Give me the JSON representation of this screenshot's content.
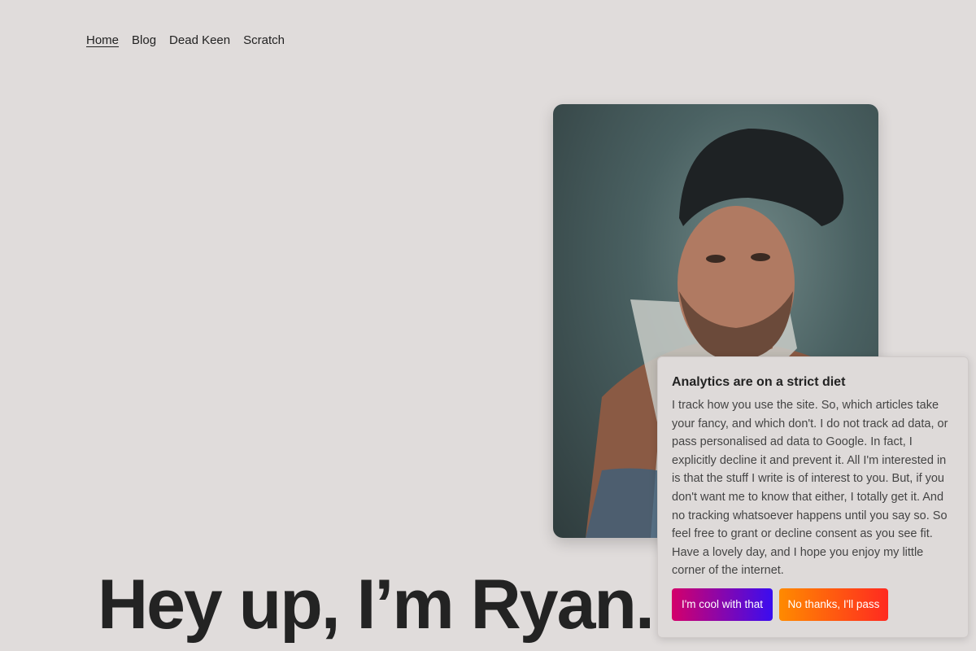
{
  "nav": {
    "items": [
      {
        "label": "Home",
        "active": true
      },
      {
        "label": "Blog",
        "active": false
      },
      {
        "label": "Dead Keen",
        "active": false
      },
      {
        "label": "Scratch",
        "active": false
      }
    ]
  },
  "hero": {
    "title": "Hey up, I’m Ryan."
  },
  "portrait": {
    "subject": "portrait-photo"
  },
  "consent": {
    "title": "Analytics are on a strict diet",
    "body": "I track how you use the site. So, which articles take your fancy, and which don't. I do not track ad data, or pass personalised ad data to Google. In fact, I explicitly decline it and prevent it. All I'm interested in is that the stuff I write is of interest to you. But, if you don't want me to know that either, I totally get it. And no tracking whatsoever happens until you say so. So feel free to grant or decline consent as you see fit. Have a lovely day, and I hope you enjoy my little corner of the internet.",
    "accept_label": "I'm cool with that",
    "decline_label": "No thanks, I'll pass"
  },
  "colors": {
    "background": "#e0dcdb",
    "accept_gradient": [
      "#d4006a",
      "#3a0df0"
    ],
    "decline_gradient": [
      "#ff8a00",
      "#ff2a20"
    ]
  }
}
